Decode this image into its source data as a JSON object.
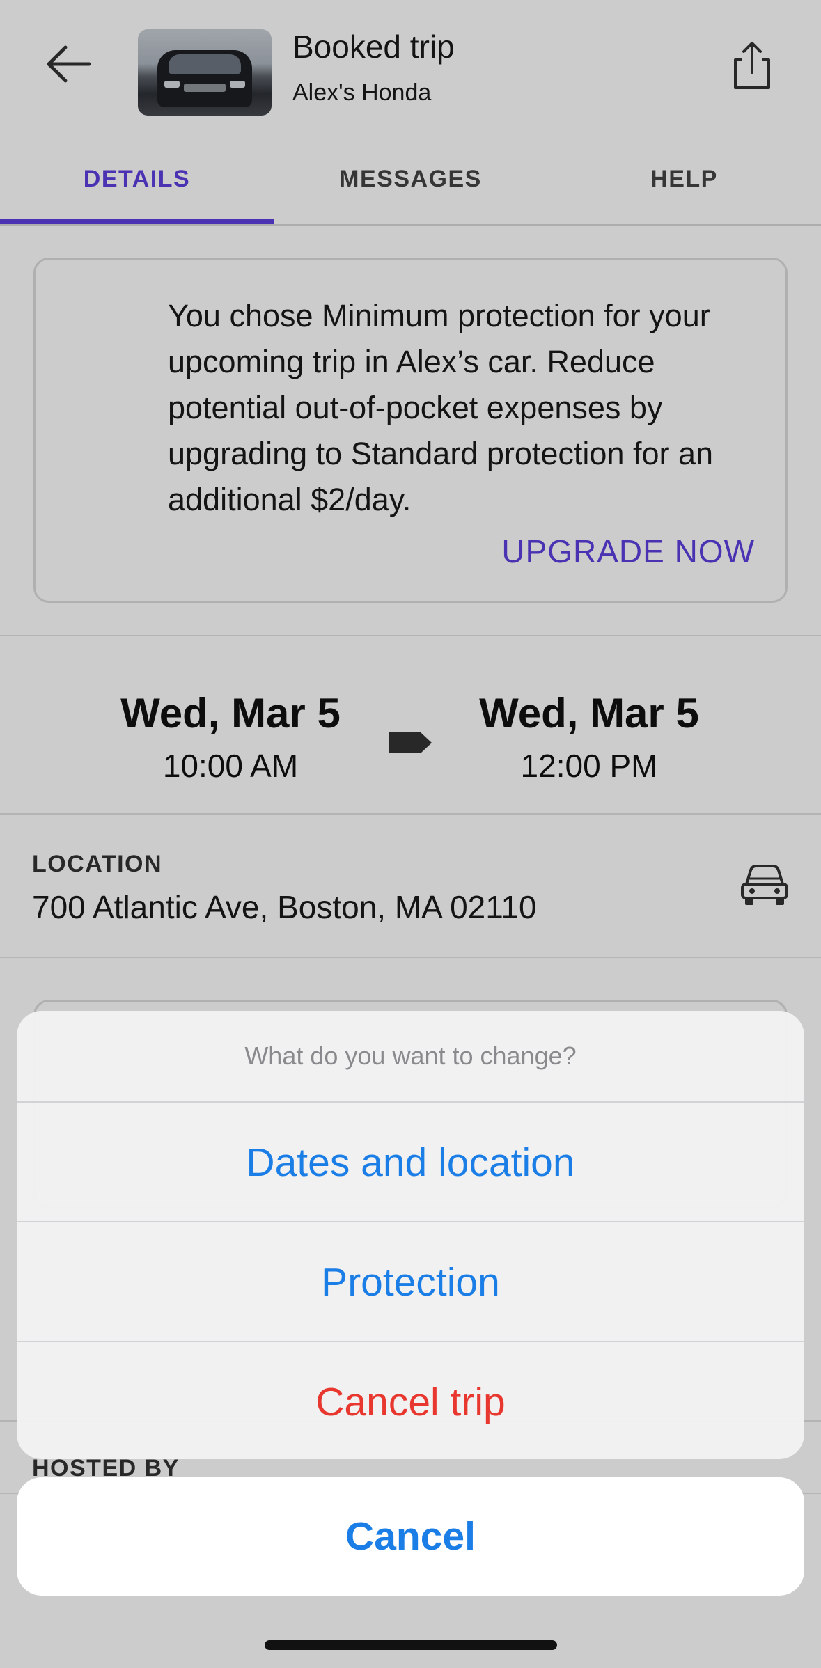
{
  "header": {
    "title": "Booked trip",
    "subtitle": "Alex's Honda"
  },
  "tabs": [
    {
      "label": "DETAILS",
      "active": true
    },
    {
      "label": "MESSAGES",
      "active": false
    },
    {
      "label": "HELP",
      "active": false
    }
  ],
  "info_card": {
    "text": "You chose Minimum protection for your upcoming trip in Alex’s car. Reduce potential out-of-pocket expenses by upgrading to Standard protection for an additional $2/day.",
    "action_label": "UPGRADE NOW"
  },
  "trip": {
    "start_date": "Wed, Mar 5",
    "start_time": "10:00 AM",
    "end_date": "Wed, Mar 5",
    "end_time": "12:00 PM"
  },
  "location": {
    "label": "LOCATION",
    "address": "700 Atlantic Ave, Boston, MA 02110"
  },
  "hosted_by_label": "HOSTED BY",
  "action_sheet": {
    "title": "What do you want to change?",
    "options": [
      {
        "label": "Dates and location"
      },
      {
        "label": "Protection"
      },
      {
        "label": "Cancel trip"
      }
    ],
    "cancel_label": "Cancel"
  },
  "colors": {
    "accent": "#5d3fe0",
    "ios_blue": "#1a7ee6",
    "destructive": "#e8372e"
  },
  "icons": [
    "back-arrow-icon",
    "share-icon",
    "arrow-tag-icon",
    "car-icon"
  ]
}
